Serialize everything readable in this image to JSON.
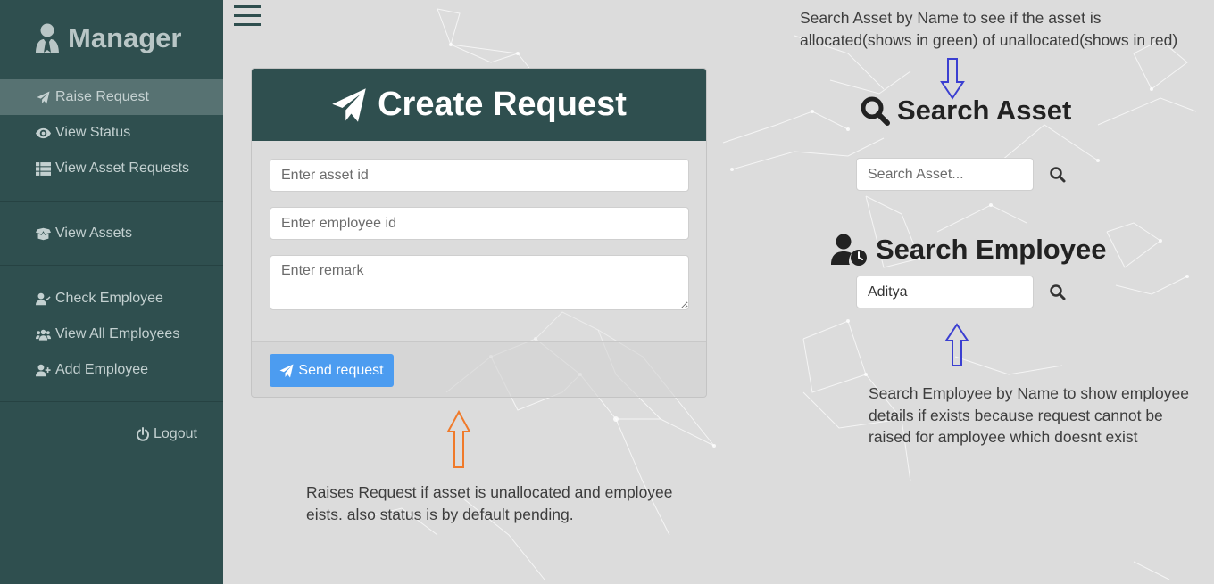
{
  "sidebar": {
    "brand": "Manager",
    "items": [
      {
        "label": "Raise Request",
        "icon": "paper-plane-icon",
        "active": true
      },
      {
        "label": "View Status",
        "icon": "eye-icon"
      },
      {
        "label": "View Asset Requests",
        "icon": "table-icon"
      },
      {
        "label": "View Assets",
        "icon": "box-open-icon"
      },
      {
        "label": "Check Employee",
        "icon": "user-check-icon"
      },
      {
        "label": "View All Employees",
        "icon": "users-icon"
      },
      {
        "label": "Add Employee",
        "icon": "user-plus-icon"
      }
    ],
    "logout": "Logout"
  },
  "create_request": {
    "title": "Create Request",
    "asset_id_placeholder": "Enter asset id",
    "employee_id_placeholder": "Enter employee id",
    "remark_placeholder": "Enter remark",
    "send_label": "Send request"
  },
  "search_asset": {
    "title": "Search Asset",
    "placeholder": "Search Asset...",
    "value": ""
  },
  "search_employee": {
    "title": "Search Employee",
    "value": "Aditya"
  },
  "notes": {
    "asset_note": "Search Asset by Name to see if the asset is allocated(shows in green) of unallocated(shows in red)",
    "request_note": "Raises Request if asset is unallocated and employee eists. also status is by default pending.",
    "employee_note": "Search Employee by Name to show employee details if exists because request cannot be raised for amployee which doesnt exist"
  },
  "colors": {
    "sidebar_bg": "#2f4f4f",
    "button_blue": "#4c9cf0",
    "arrow_orange": "#f07a2a",
    "arrow_blue": "#3b3fd1"
  }
}
